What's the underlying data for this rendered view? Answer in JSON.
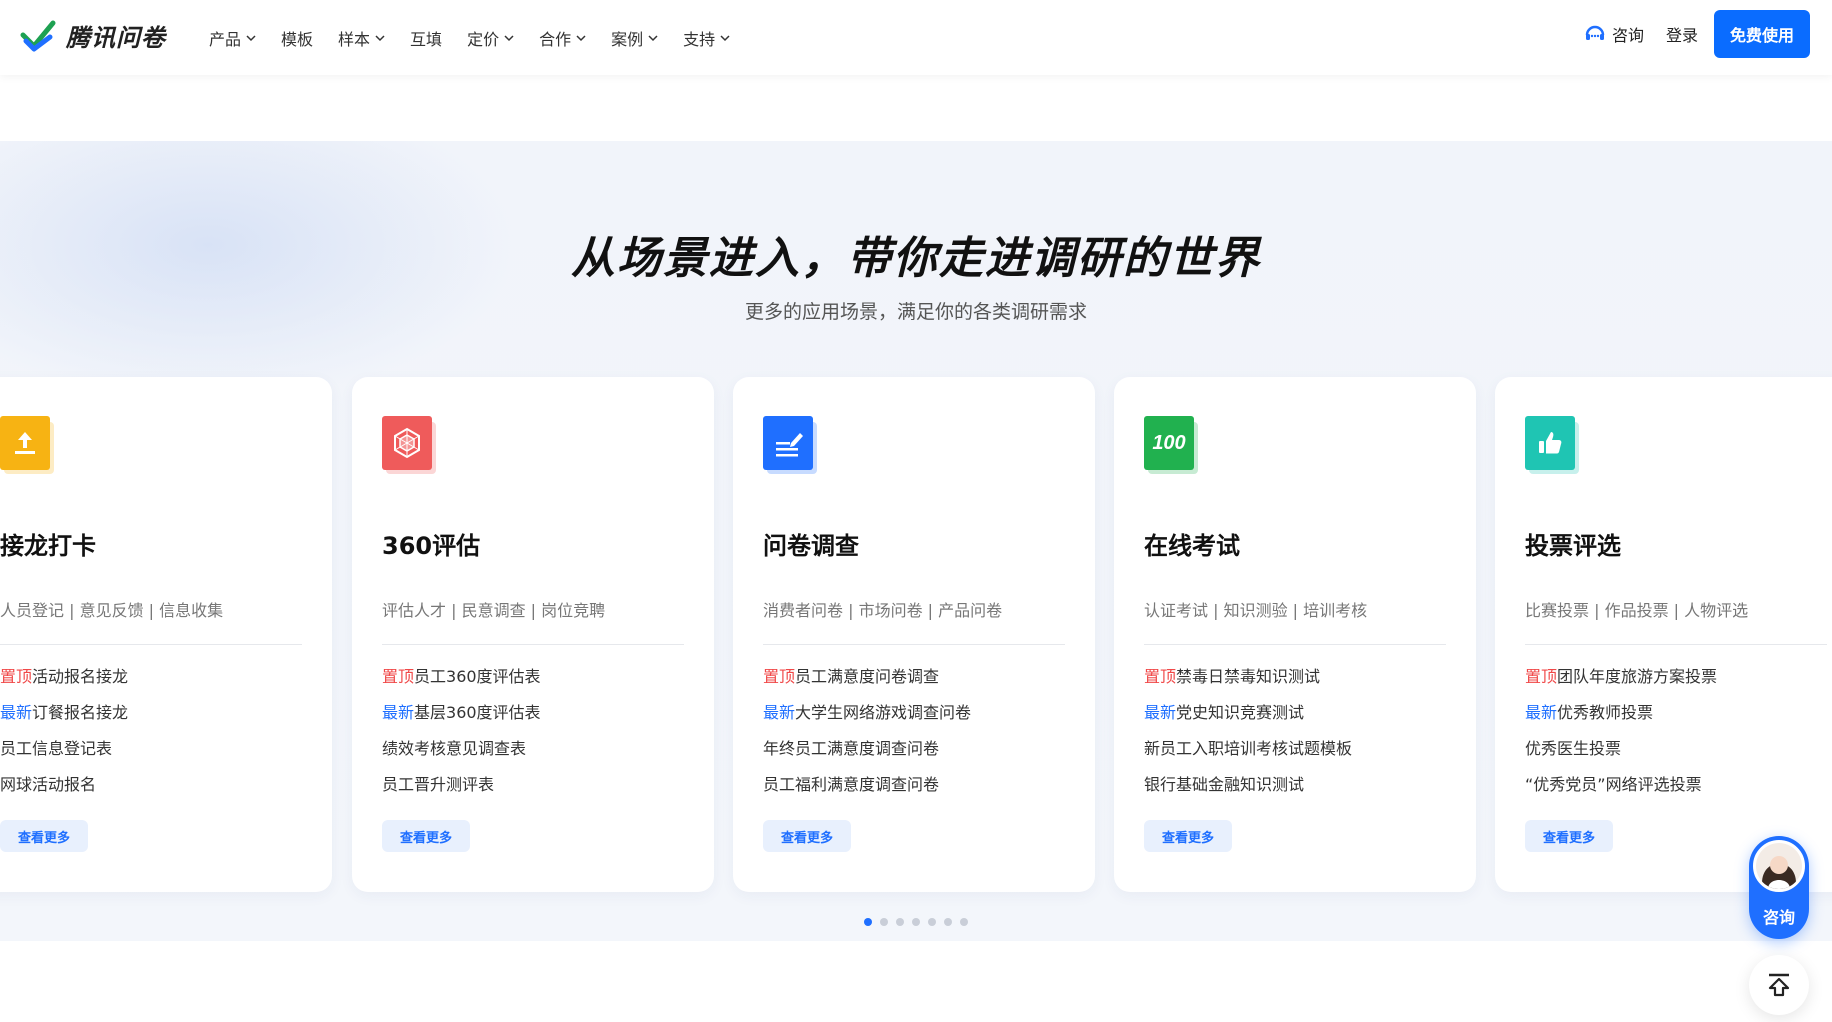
{
  "header": {
    "logo_text": "腾讯问卷",
    "nav": [
      {
        "label": "产品",
        "dropdown": true
      },
      {
        "label": "模板",
        "dropdown": false
      },
      {
        "label": "样本",
        "dropdown": true
      },
      {
        "label": "互填",
        "dropdown": false
      },
      {
        "label": "定价",
        "dropdown": true
      },
      {
        "label": "合作",
        "dropdown": true
      },
      {
        "label": "案例",
        "dropdown": true
      },
      {
        "label": "支持",
        "dropdown": true
      }
    ],
    "consult_label": "咨询",
    "login_label": "登录",
    "free_label": "免费使用"
  },
  "section": {
    "title": "从场景进入，带你走进调研的世界",
    "subtitle": "更多的应用场景，满足你的各类调研需求"
  },
  "cards": [
    {
      "title": "接龙打卡",
      "tags": "人员登记 | 意见反馈 | 信息收集",
      "icon": "upload-icon",
      "color": "#f7b313",
      "items": [
        {
          "badge": "置顶",
          "badge_type": "top",
          "text": "活动报名接龙"
        },
        {
          "badge": "最新",
          "badge_type": "new",
          "text": "订餐报名接龙"
        },
        {
          "badge": "",
          "badge_type": "",
          "text": "员工信息登记表"
        },
        {
          "badge": "",
          "badge_type": "",
          "text": "网球活动报名"
        }
      ],
      "more_label": "查看更多"
    },
    {
      "title": "360评估",
      "tags": "评估人才 |  民意调查 | 岗位竞聘",
      "icon": "radar-icon",
      "color": "#ef5b5b",
      "items": [
        {
          "badge": "置顶",
          "badge_type": "top",
          "text": "员工360度评估表"
        },
        {
          "badge": "最新",
          "badge_type": "new",
          "text": "基层360度评估表"
        },
        {
          "badge": "",
          "badge_type": "",
          "text": "绩效考核意见调查表"
        },
        {
          "badge": "",
          "badge_type": "",
          "text": "员工晋升测评表"
        }
      ],
      "more_label": "查看更多"
    },
    {
      "title": "问卷调查",
      "tags": "消费者问卷 | 市场问卷 | 产品问卷",
      "icon": "edit-document-icon",
      "color": "#1f6fff",
      "items": [
        {
          "badge": "置顶",
          "badge_type": "top",
          "text": "员工满意度问卷调查"
        },
        {
          "badge": "最新",
          "badge_type": "new",
          "text": "大学生网络游戏调查问卷"
        },
        {
          "badge": "",
          "badge_type": "",
          "text": "年终员工满意度调查问卷"
        },
        {
          "badge": "",
          "badge_type": "",
          "text": "员工福利满意度调查问卷"
        }
      ],
      "more_label": "查看更多"
    },
    {
      "title": "在线考试",
      "tags": "认证考试 | 知识测验 | 培训考核",
      "icon": "score-100-icon",
      "icon_text": "100",
      "color": "#21b14f",
      "items": [
        {
          "badge": "置顶",
          "badge_type": "top",
          "text": "禁毒日禁毒知识测试"
        },
        {
          "badge": "最新",
          "badge_type": "new",
          "text": "党史知识竞赛测试"
        },
        {
          "badge": "",
          "badge_type": "",
          "text": "新员工入职培训考核试题模板"
        },
        {
          "badge": "",
          "badge_type": "",
          "text": "银行基础金融知识测试"
        }
      ],
      "more_label": "查看更多"
    },
    {
      "title": "投票评选",
      "tags": "比赛投票 | 作品投票 | 人物评选",
      "icon": "thumbs-up-icon",
      "color": "#1fc5b3",
      "items": [
        {
          "badge": "置顶",
          "badge_type": "top",
          "text": "团队年度旅游方案投票"
        },
        {
          "badge": "最新",
          "badge_type": "new",
          "text": "优秀教师投票"
        },
        {
          "badge": "",
          "badge_type": "",
          "text": "优秀医生投票"
        },
        {
          "badge": "",
          "badge_type": "",
          "text": "“优秀党员”网络评选投票"
        }
      ],
      "more_label": "查看更多"
    }
  ],
  "carousel": {
    "dot_count": 7,
    "active_index": 0
  },
  "float": {
    "consult_label": "咨询"
  },
  "colors": {
    "accent": "#1f6fff",
    "top_badge": "#f04848",
    "new_badge": "#1f6fff"
  }
}
